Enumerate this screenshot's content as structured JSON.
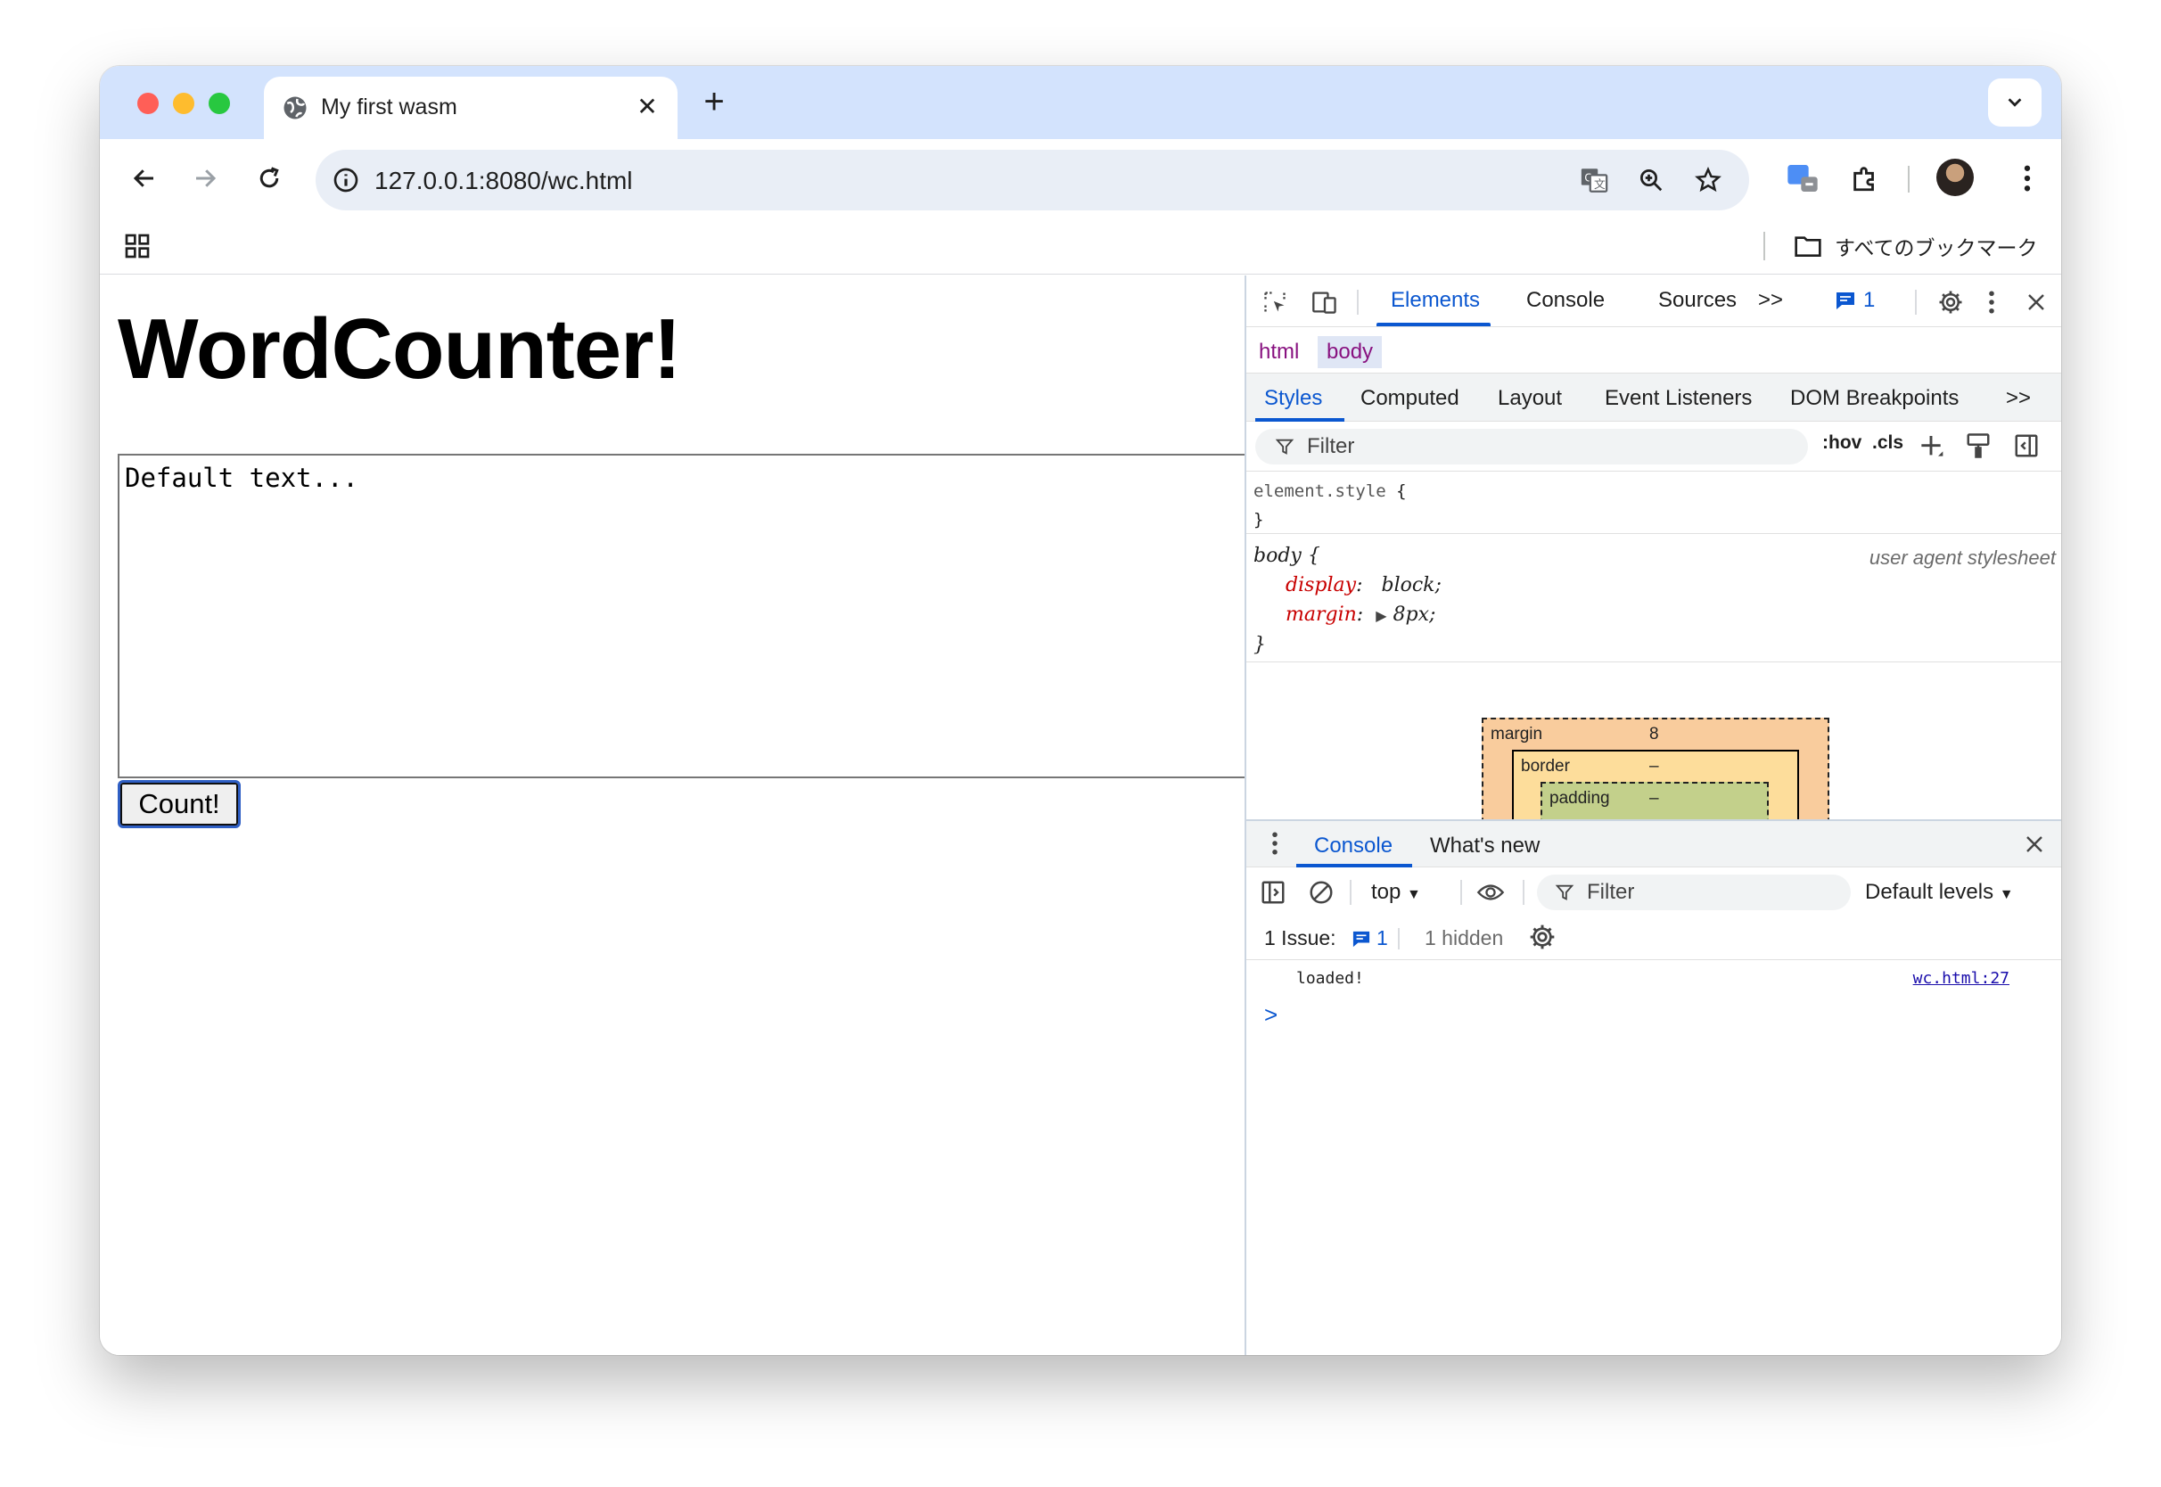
{
  "browser": {
    "tab_title": "My first wasm",
    "url": "127.0.0.1:8080/wc.html",
    "bookmarks_all_label": "すべてのブックマーク"
  },
  "page": {
    "heading": "WordCounter!",
    "textarea_value": "Default text...",
    "count_button_label": "Count!"
  },
  "devtools": {
    "tabs": [
      "Elements",
      "Console",
      "Sources"
    ],
    "more_tabs_glyph": ">>",
    "issues_count": "1",
    "breadcrumbs": [
      "html",
      "body"
    ],
    "subtabs": [
      "Styles",
      "Computed",
      "Layout",
      "Event Listeners",
      "DOM Breakpoints"
    ],
    "filter_placeholder": "Filter",
    "hov_label": ":hov",
    "cls_label": ".cls",
    "element_style_selector": "element.style",
    "rule_selector": "body",
    "rule_source": "user agent stylesheet",
    "props": [
      {
        "name": "display",
        "value": "block;"
      },
      {
        "name": "margin",
        "value": "8px;"
      }
    ],
    "box_model": {
      "margin_label": "margin",
      "margin_value": "8",
      "border_label": "border",
      "border_value": "–",
      "padding_label": "padding",
      "padding_value": "–"
    },
    "drawer": {
      "tabs": [
        "Console",
        "What's new"
      ],
      "context": "top",
      "filter_placeholder": "Filter",
      "levels": "Default levels",
      "issues_label": "1 Issue:",
      "issues_count": "1",
      "hidden_label": "1 hidden",
      "log_message": "loaded!",
      "log_source": "wc.html:27",
      "prompt_glyph": ">"
    }
  },
  "colors": {
    "accent": "#0b57d0",
    "tabstrip": "#d3e3fd",
    "css_property": "#c80000",
    "dom_tag": "#881280"
  }
}
